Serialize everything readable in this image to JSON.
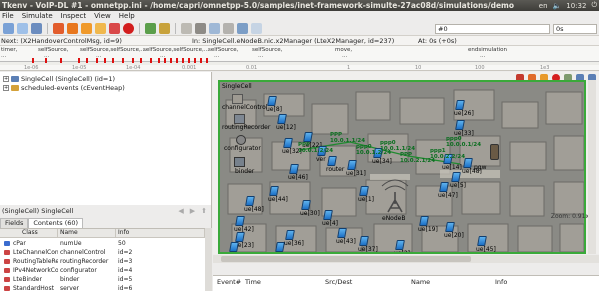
{
  "window": {
    "title": "Tkenv - VoIP-DL #1 - omnetpp.ini - /home/capri/omnetpp-5.0/samples/inet-framework-simulte-27ac08d/simulations/demo",
    "tray": [
      "en",
      "10:32"
    ]
  },
  "menubar": [
    "File",
    "Simulate",
    "Inspect",
    "View",
    "Help"
  ],
  "toolbar": {
    "event_counter": "#0",
    "time_counter": "0s"
  },
  "statusbar": {
    "next": "Next: (X2HandoverControlMsg, id=9)",
    "in": "In: SingleCell.eNodeB.nic.x2Manager (LteX2Manager, id=237)",
    "at": "At: 0s (+0s)"
  },
  "timeline": {
    "top_labels": [
      "timer,",
      "selfSource,",
      "selfSource,selfSource,...",
      "selfSource,selfSource,...",
      "selfSource,",
      "selfSource,",
      "move,",
      "endsimulation"
    ],
    "sub_labels": [
      "...",
      "...",
      "...",
      "...",
      "...",
      "...",
      "...",
      "..."
    ],
    "ticks": [
      "1e-06",
      "1e-05",
      "1e-04",
      "0.001",
      "0.01",
      "1",
      "10",
      "100",
      "1e3"
    ]
  },
  "tree": [
    {
      "expander": "+",
      "label": "SingleCell (SingleCell) (id=1)"
    },
    {
      "expander": "+",
      "label": "scheduled-events (cEventHeap)"
    }
  ],
  "inspector": {
    "title": "(SingleCell) SingleCell",
    "tabs": [
      "Fields",
      "Contents (60)"
    ],
    "nav": [
      "◀",
      "▶",
      "⬆"
    ],
    "columns": [
      "Class",
      "Name",
      "Info"
    ],
    "rows": [
      {
        "cls": "cPar",
        "name": "numUe",
        "info": "50",
        "color": "#3a6ccf"
      },
      {
        "cls": "LteChannelContr",
        "name": "channelControl",
        "info": "id=2",
        "color": "#c44"
      },
      {
        "cls": "RoutingTableRec",
        "name": "routingRecorder",
        "info": "id=3",
        "color": "#c44"
      },
      {
        "cls": "IPv4NetworkConf",
        "name": "configurator",
        "info": "id=4",
        "color": "#c44"
      },
      {
        "cls": "LteBinder",
        "name": "binder",
        "info": "id=5",
        "color": "#c44"
      },
      {
        "cls": "StandardHost",
        "name": "server",
        "info": "id=6",
        "color": "#c44"
      }
    ]
  },
  "network": {
    "module": "SingleCell",
    "submodules": [
      "channelControl",
      "routingRecorder",
      "configurator",
      "binder"
    ],
    "nodes": [
      "ue[8]",
      "ue[12]",
      "ue[32]",
      "ue[22]",
      "ver",
      "router",
      "ue[34]",
      "ue[26]",
      "ue[33]",
      "ue[46]",
      "ue[31]",
      "ue[14]",
      "ue[48]",
      "ue[5]",
      "ue[47]",
      "ue[44]",
      "ue[1]",
      "ue[30]",
      "ue[4]",
      "ue[48]",
      "ue[42]",
      "ue[23]",
      "ue[36]",
      "ue[19]",
      "ue[20]",
      "ue[43]",
      "ue[37]",
      "ue[45]",
      "ue[0]",
      "1.Ue[36]",
      "ue[2]",
      "eNodeB",
      "pgw"
    ],
    "packets": [
      "PPP",
      "10.0.1.2/24",
      "PPP",
      "10.0.1.1/24",
      "ppp0",
      "10.0.1.2/24",
      "ppp0",
      "10.0.1.1/24",
      "PPP",
      "10.0.2.1/24",
      "ppp1",
      "10.0.2.2/24",
      "ppp0",
      "10.0.0.1/24"
    ],
    "zoom": "Zoom: 0.91x",
    "toolbar_icons": [
      "step-back-icon",
      "step-icon",
      "run-icon",
      "stop-icon",
      "search-icon",
      "zoom-in-icon",
      "zoom-out-icon"
    ]
  },
  "eventlog": {
    "columns": [
      "Event#",
      "Time",
      "Src/Dest",
      "Name",
      "Info"
    ]
  }
}
